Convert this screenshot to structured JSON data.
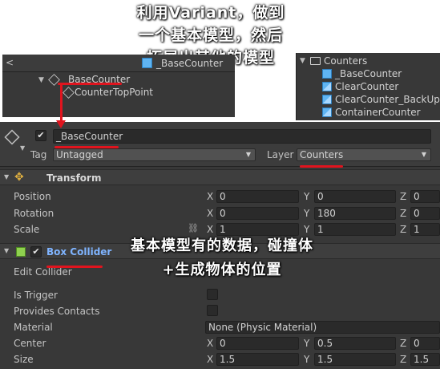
{
  "captions": {
    "top": "利用Variant，做到一个基本模型，然后拓展出其他的模型",
    "middle": "基本模型有的数据，碰撞体+生成物体的位置"
  },
  "colors": {
    "annotation_red": "#e0141e",
    "prefab_blue": "#5fb4f2",
    "link_blue": "#7fb4ff"
  },
  "hierarchy": {
    "header_title": "_BaseCounter",
    "items": [
      {
        "label": "_BaseCounter",
        "icon": "gameobject-icon"
      },
      {
        "label": "CounterTopPoint",
        "icon": "gameobject-icon"
      }
    ]
  },
  "project": {
    "folder": "Counters",
    "items": [
      {
        "label": "_BaseCounter",
        "icon": "prefab-icon"
      },
      {
        "label": "ClearCounter",
        "icon": "prefab-variant-icon"
      },
      {
        "label": "ClearCounter_BackUp",
        "icon": "prefab-variant-icon"
      },
      {
        "label": "ContainerCounter",
        "icon": "prefab-variant-icon"
      }
    ]
  },
  "inspector": {
    "object_name": "_BaseCounter",
    "tag_label": "Tag",
    "tag_value": "Untagged",
    "layer_label": "Layer",
    "layer_value": "Counters",
    "transform": {
      "title": "Transform",
      "position_label": "Position",
      "rotation_label": "Rotation",
      "scale_label": "Scale",
      "position": {
        "x": "0",
        "y": "0",
        "z": "0"
      },
      "rotation": {
        "x": "0",
        "y": "180",
        "z": "0"
      },
      "scale": {
        "x": "1",
        "y": "1",
        "z": "1"
      }
    },
    "collider": {
      "title": "Box Collider",
      "edit_label": "Edit Collider",
      "trigger_label": "Is Trigger",
      "contacts_label": "Provides Contacts",
      "material_label": "Material",
      "material_value": "None (Physic Material)",
      "center_label": "Center",
      "size_label": "Size",
      "center": {
        "x": "0",
        "y": "0.5",
        "z": "0"
      },
      "size": {
        "x": "1.5",
        "y": "1.5",
        "z": "1.5"
      }
    },
    "axes": {
      "x": "X",
      "y": "Y",
      "z": "Z"
    }
  }
}
